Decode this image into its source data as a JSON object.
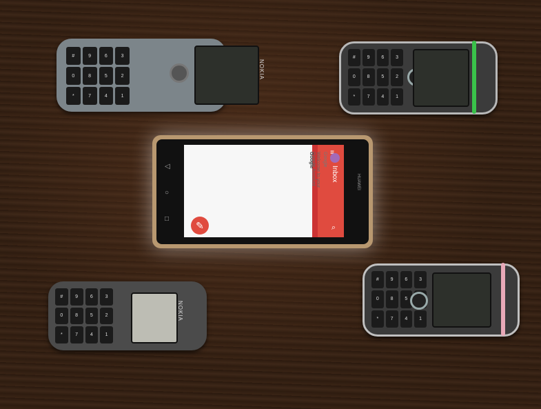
{
  "scene": {
    "feature_phone_brand": "NOKIA",
    "smartphone_brand": "HUAWEI",
    "smartphone_screen": {
      "app_title": "Inbox",
      "email": {
        "sender": "Google",
        "subject": "Google",
        "snippet": "Welcome to your Google Account"
      },
      "icons": [
        "menu-icon",
        "search-icon",
        "compose-icon",
        "back-icon",
        "home-icon",
        "recents-icon"
      ]
    },
    "colors": {
      "table": "#301e12",
      "app_accent": "#e04b3f"
    }
  }
}
